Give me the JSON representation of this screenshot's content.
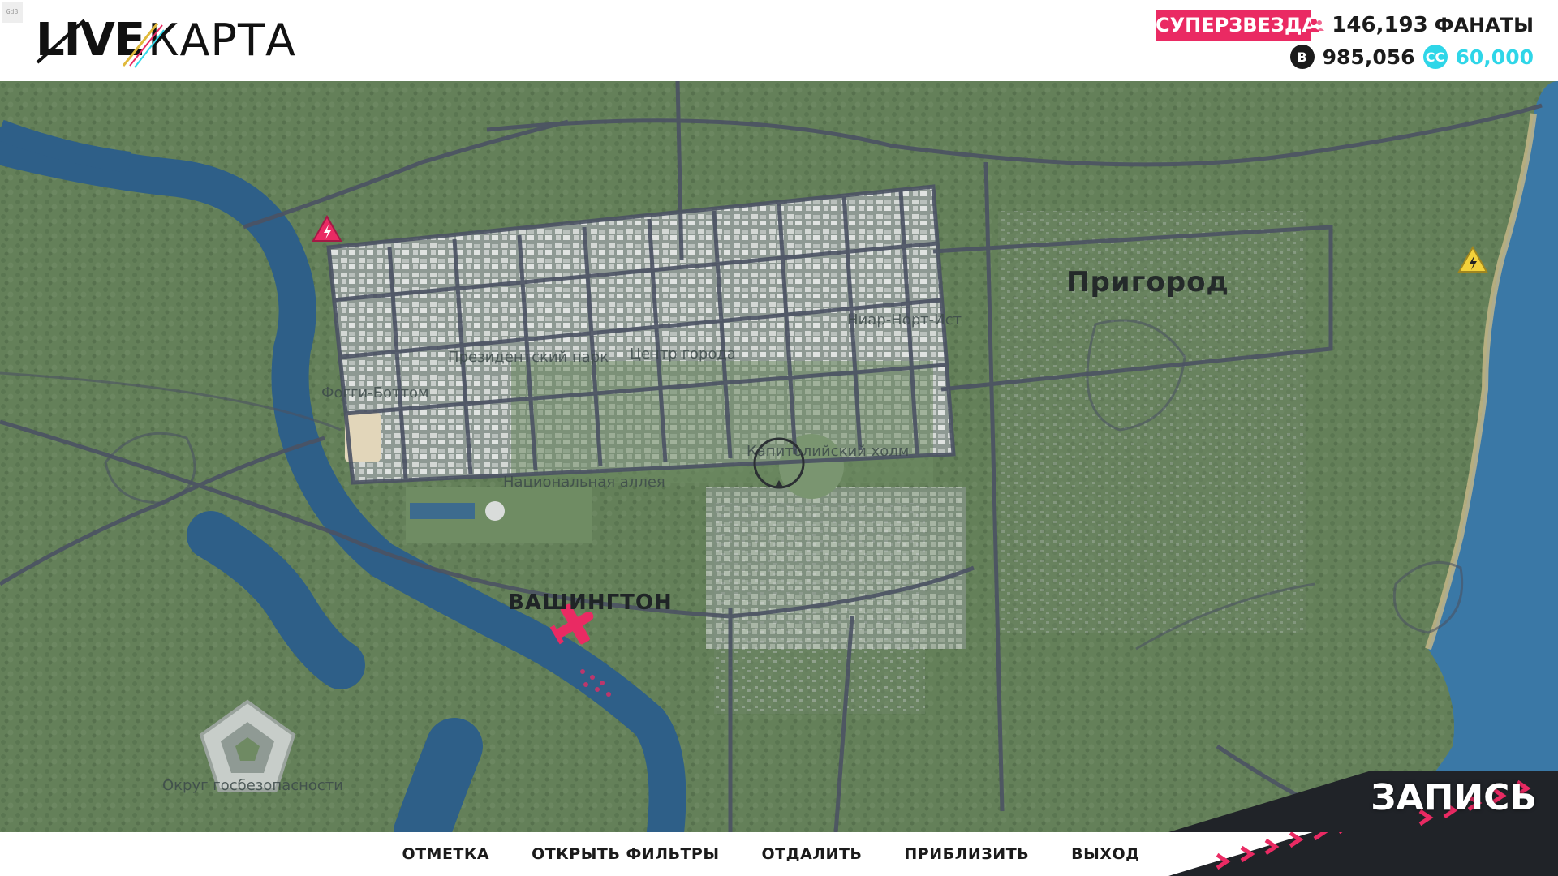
{
  "header": {
    "build_tag": "GdB",
    "logo_live": "LIVE",
    "logo_map": "КАРТА",
    "rank": "СУПЕРЗВЕЗДА",
    "fans_count": "146,193",
    "fans_label": "ФАНАТЫ",
    "bits": "985,056",
    "credits": "60,000",
    "accent_color": "#ea2a63",
    "credit_color": "#2fd6e8"
  },
  "map": {
    "region_label": "Пригород",
    "city_label": "ВАШИНГТОН",
    "districts": [
      "Ниар-Норт-Ист",
      "Президентский парк",
      "Центр города",
      "Фогги-Боттом",
      "Капитолийский холм",
      "Национальная аллея",
      "Округ госбезопасности"
    ],
    "icons": [
      "event-marker-icon",
      "event-marker-icon",
      "airplane-icon",
      "crosshair-icon"
    ]
  },
  "record_label": "ЗАПИСЬ",
  "footer": {
    "actions": [
      "ОТМЕТКА",
      "ОТКРЫТЬ ФИЛЬТРЫ",
      "ОТДАЛИТЬ",
      "ПРИБЛИЗИТЬ",
      "ВЫХОД"
    ]
  }
}
